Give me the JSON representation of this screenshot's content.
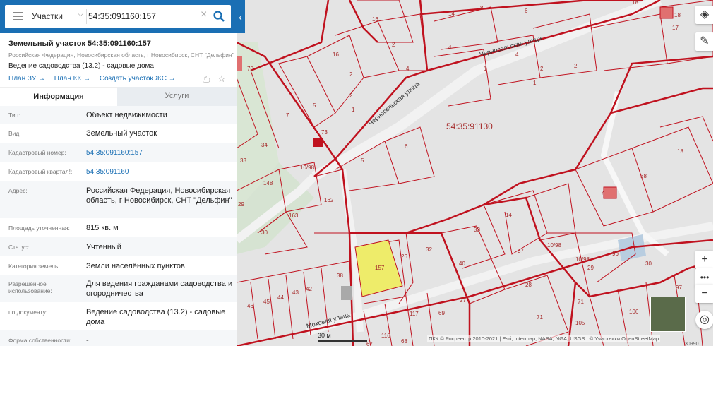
{
  "search": {
    "category": "Участки",
    "query": "54:35:091160:157"
  },
  "object": {
    "title": "Земельный участок 54:35:091160:157",
    "address": "Российская Федерация, Новосибирская область, г Новосибирск, СНТ \"Дельфин\"",
    "use": "Ведение садоводства (13.2) - садовые дома",
    "links": [
      "План ЗУ →",
      "План КК →",
      "Создать участок ЖС →"
    ]
  },
  "tabs": {
    "info": "Информация",
    "services": "Услуги"
  },
  "rows": [
    {
      "label": "Тип:",
      "value": "Объект недвижимости"
    },
    {
      "label": "Вид:",
      "value": "Земельный участок"
    },
    {
      "label": "Кадастровый номер:",
      "value": "54:35:091160:157"
    },
    {
      "label": "Кадастровый квартал!:",
      "value": "54:35:091160"
    },
    {
      "label": "Адрес:",
      "value": "Российская Федерация, Новосибирская область, г Новосибирск, СНТ \"Дельфин\""
    },
    {
      "label": "Площадь уточненная:",
      "value": "815 кв. м"
    },
    {
      "label": "Статус:",
      "value": "Учтенный"
    },
    {
      "label": "Категория земель:",
      "value": "Земли населённых пунктов"
    },
    {
      "label": "Разрешенное использование:",
      "value": "Для ведения гражданами садоводства и огородничества"
    },
    {
      "label": "по документу:",
      "value": "Ведение садоводства (13.2) - садовые дома"
    },
    {
      "label": "Форма собственности:",
      "value": "-"
    }
  ],
  "map": {
    "quarter": "54:35:91130",
    "streets": [
      "Черносельская улица",
      "Черносельская улица",
      "Моховая улица"
    ],
    "selected_parcel": "157",
    "scale": "30 м",
    "attribution": "ПКК © Росреестр 2010-2021 | Esri, Intermap, NASA, NGA, USGS | © Участники OpenStreetMap",
    "edge_number": "30990",
    "parcels": [
      "14",
      "8",
      "6",
      "18",
      "17",
      "18",
      "16",
      "2",
      "16",
      "4",
      "4",
      "1",
      "4",
      "2",
      "2",
      "1",
      "7",
      "5",
      "2",
      "2",
      "1",
      "6",
      "5",
      "34",
      "33",
      "148",
      "162",
      "29",
      "163",
      "30",
      "18",
      "38",
      "7",
      "14",
      "33",
      "37",
      "32",
      "26",
      "38",
      "40",
      "28",
      "29",
      "30",
      "96",
      "97",
      "71",
      "106",
      "105",
      "46",
      "45",
      "44",
      "43",
      "42",
      "67",
      "117",
      "116",
      "68",
      "69",
      "27",
      "71",
      "10/98",
      "10/98",
      "10/98",
      "70",
      "73"
    ],
    "colors": {
      "boundary": "#c0121f",
      "selected": "#eeec6a",
      "building": "#e07070"
    }
  },
  "icons": [
    "layers-icon",
    "ruler-icon",
    "zoom-in-icon",
    "more-icon",
    "zoom-out-icon",
    "locate-icon",
    "search-icon",
    "star-icon",
    "print-icon"
  ]
}
